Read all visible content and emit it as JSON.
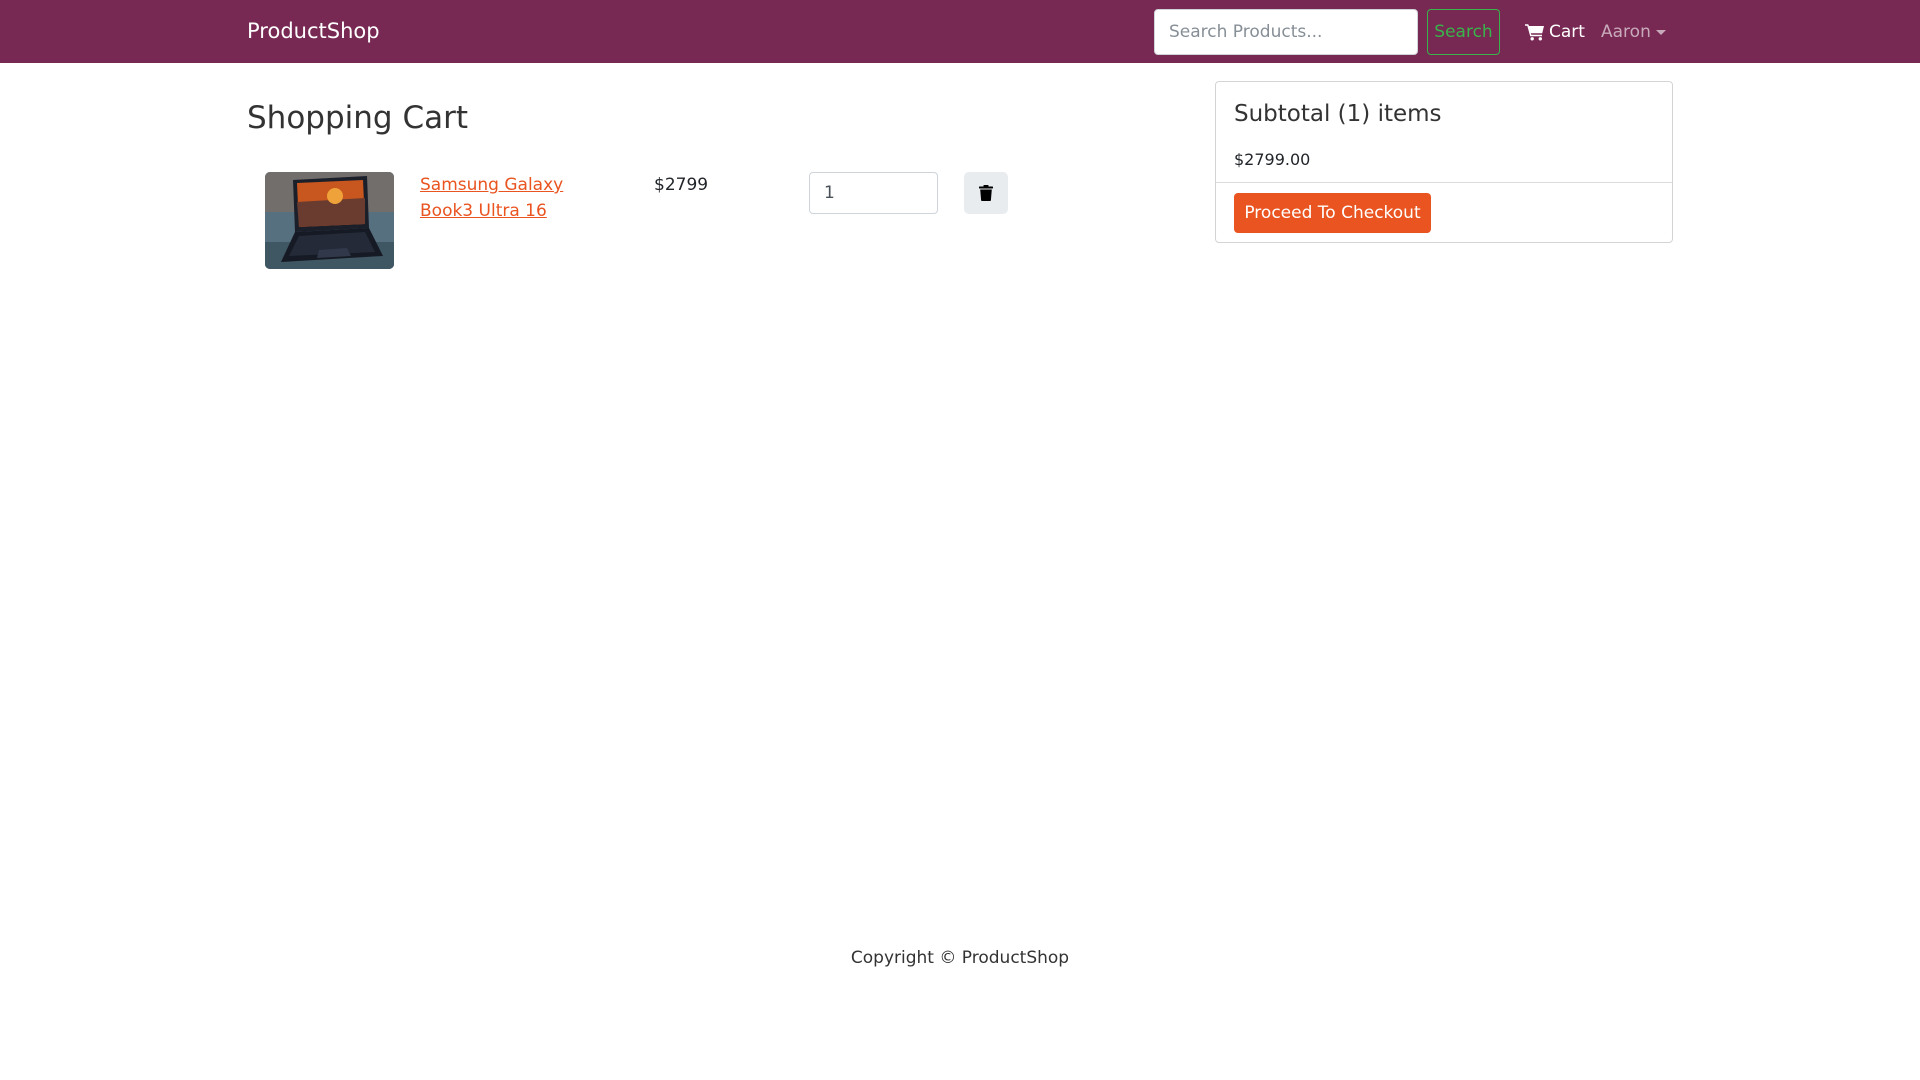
{
  "navbar": {
    "brand": "ProductShop",
    "search_placeholder": "Search Products...",
    "search_button": "Search",
    "cart_label": "Cart",
    "user_name": "Aaron"
  },
  "page": {
    "title": "Shopping Cart"
  },
  "cart": {
    "items": [
      {
        "name": "Samsung Galaxy Book3 Ultra 16",
        "price": "$2799",
        "quantity": "1"
      }
    ]
  },
  "summary": {
    "title": "Subtotal (1) items",
    "amount": "$2799.00",
    "checkout_button": "Proceed To Checkout"
  },
  "footer": {
    "copyright": "Copyright © ProductShop"
  },
  "colors": {
    "navbar_bg": "#772953",
    "accent": "#e95420",
    "search_outline": "#38b44a"
  },
  "icons": {
    "cart": "shopping-cart-icon",
    "delete": "trash-icon",
    "user_dropdown": "caret-down-icon"
  }
}
